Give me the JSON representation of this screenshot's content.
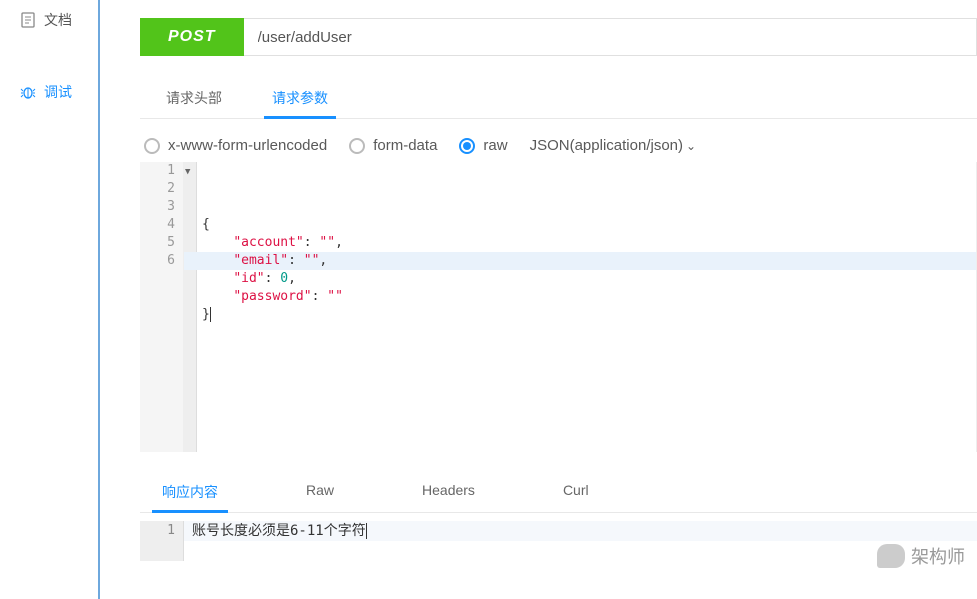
{
  "sidebar": {
    "docs_label": "文档",
    "debug_label": "调试"
  },
  "request": {
    "method": "POST",
    "url": "/user/addUser"
  },
  "tabs": {
    "headers": "请求头部",
    "params": "请求参数"
  },
  "body_types": {
    "urlencoded": "x-www-form-urlencoded",
    "formdata": "form-data",
    "raw": "raw",
    "content_type": "JSON(application/json)"
  },
  "code": {
    "line1": "{",
    "line2_key": "\"account\"",
    "line2_val": "\"\"",
    "line3_key": "\"email\"",
    "line3_val": "\"\"",
    "line4_key": "\"id\"",
    "line4_val": "0",
    "line5_key": "\"password\"",
    "line5_val": "\"\"",
    "line6": "}",
    "gutter": [
      "1",
      "2",
      "3",
      "4",
      "5",
      "6"
    ]
  },
  "response_tabs": {
    "content": "响应内容",
    "raw": "Raw",
    "headers": "Headers",
    "curl": "Curl"
  },
  "response": {
    "gutter1": "1",
    "body": "账号长度必须是6-11个字符"
  },
  "watermark": "架构师"
}
